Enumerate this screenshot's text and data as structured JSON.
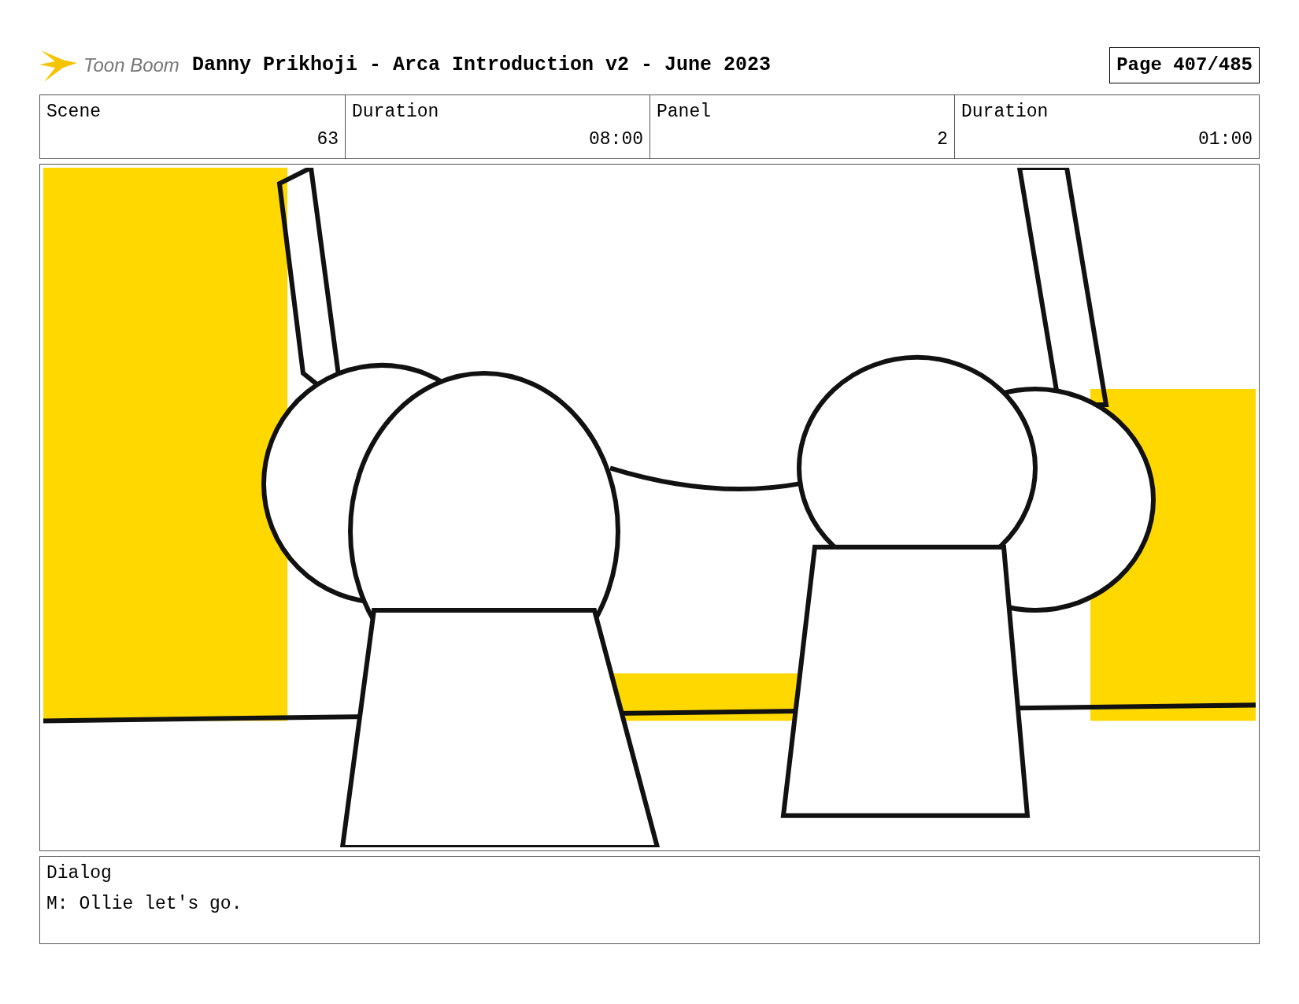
{
  "header": {
    "logo": "Toon Boom",
    "title": "Danny Prikhoji - Arca Introduction v2 - June 2023",
    "page": "Page 407/485"
  },
  "info_table": {
    "columns": [
      "Scene",
      "Duration",
      "Panel",
      "Duration"
    ],
    "rows": [
      [
        "63",
        "08:00",
        "2",
        "01:00"
      ]
    ]
  },
  "dialog": {
    "label": "Dialog",
    "text": "M: Ollie let's go."
  }
}
